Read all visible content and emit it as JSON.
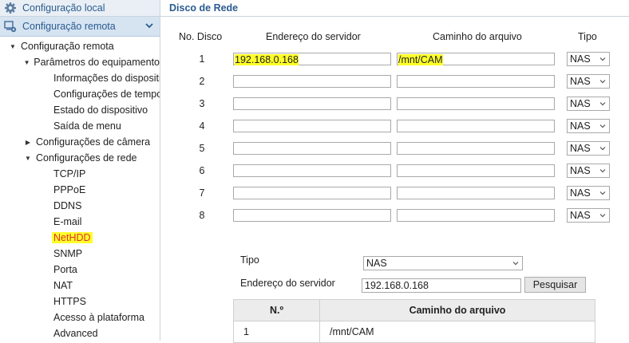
{
  "sidebar": {
    "local_config": "Configuração local",
    "remote_config": "Configuração remota",
    "tree": {
      "root": "Configuração remota",
      "device_params": "Parâmetros do equipamento",
      "device_params_children": [
        "Informações do dispositivo",
        "Configurações de tempo",
        "Estado do dispositivo",
        "Saída de menu"
      ],
      "camera_settings": "Configurações de câmera",
      "network_settings": "Configurações de rede",
      "network_children": [
        "TCP/IP",
        "PPPoE",
        "DDNS",
        "E-mail",
        "NetHDD",
        "SNMP",
        "Porta",
        "NAT",
        "HTTPS",
        "Acesso à plataforma",
        "Advanced"
      ]
    }
  },
  "main": {
    "title": "Disco de Rede",
    "headers": {
      "no": "No. Disco",
      "server": "Endereço do servidor",
      "path": "Caminho do arquivo",
      "type": "Tipo"
    },
    "rows": [
      {
        "no": "1",
        "server": "192.168.0.168",
        "path": "/mnt/CAM",
        "type": "NAS"
      },
      {
        "no": "2",
        "server": "",
        "path": "",
        "type": "NAS"
      },
      {
        "no": "3",
        "server": "",
        "path": "",
        "type": "NAS"
      },
      {
        "no": "4",
        "server": "",
        "path": "",
        "type": "NAS"
      },
      {
        "no": "5",
        "server": "",
        "path": "",
        "type": "NAS"
      },
      {
        "no": "6",
        "server": "",
        "path": "",
        "type": "NAS"
      },
      {
        "no": "7",
        "server": "",
        "path": "",
        "type": "NAS"
      },
      {
        "no": "8",
        "server": "",
        "path": "",
        "type": "NAS"
      }
    ],
    "search": {
      "type_label": "Tipo",
      "type_value": "NAS",
      "server_label": "Endereço do servidor",
      "server_value": "192.168.0.168",
      "button": "Pesquisar"
    },
    "results": {
      "headers": {
        "no": "N.º",
        "path": "Caminho do arquivo"
      },
      "rows": [
        {
          "no": "1",
          "path": "/mnt/CAM"
        }
      ]
    }
  },
  "colors": {
    "accent": "#2a5b8f",
    "highlight": "#ffff2a",
    "active_item": "#e0322b"
  }
}
